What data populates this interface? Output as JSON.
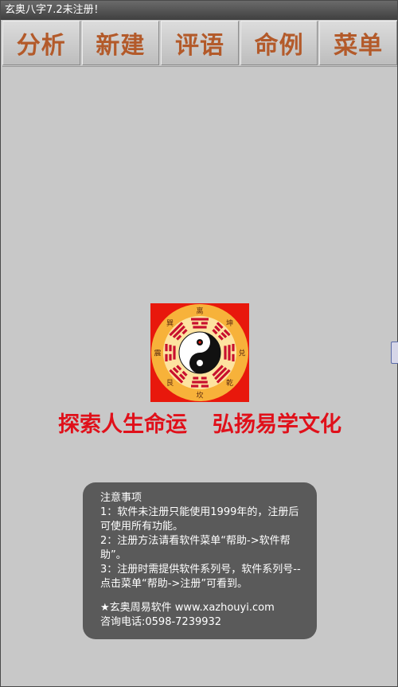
{
  "window": {
    "title": "玄奥八字7.2未注册！"
  },
  "toolbar": {
    "tabs": [
      {
        "label": "分析"
      },
      {
        "label": "新建"
      },
      {
        "label": "评语"
      },
      {
        "label": "命例"
      },
      {
        "label": "菜单"
      }
    ]
  },
  "logo": {
    "trigrams": [
      "离",
      "坤",
      "兑",
      "乾",
      "坎",
      "艮",
      "震",
      "巽"
    ],
    "colors": {
      "background": "#e8180c",
      "ring": "#f7b23a",
      "bars": "#c8102e"
    }
  },
  "slogan": {
    "left": "探索人生命运",
    "right": "弘扬易学文化"
  },
  "notice": {
    "title": "注意事项",
    "items": [
      "1：软件未注册只能使用1999年的，注册后可使用所有功能。",
      "2：注册方法请看软件菜单“帮助->软件帮助”。",
      "3：注册时需提供软件系列号，软件系列号--点击菜单“帮助->注册”可看到。"
    ],
    "company": "★玄奥周易软件 www.xazhouyi.com",
    "phone": "咨询电话:0598-7239932"
  }
}
